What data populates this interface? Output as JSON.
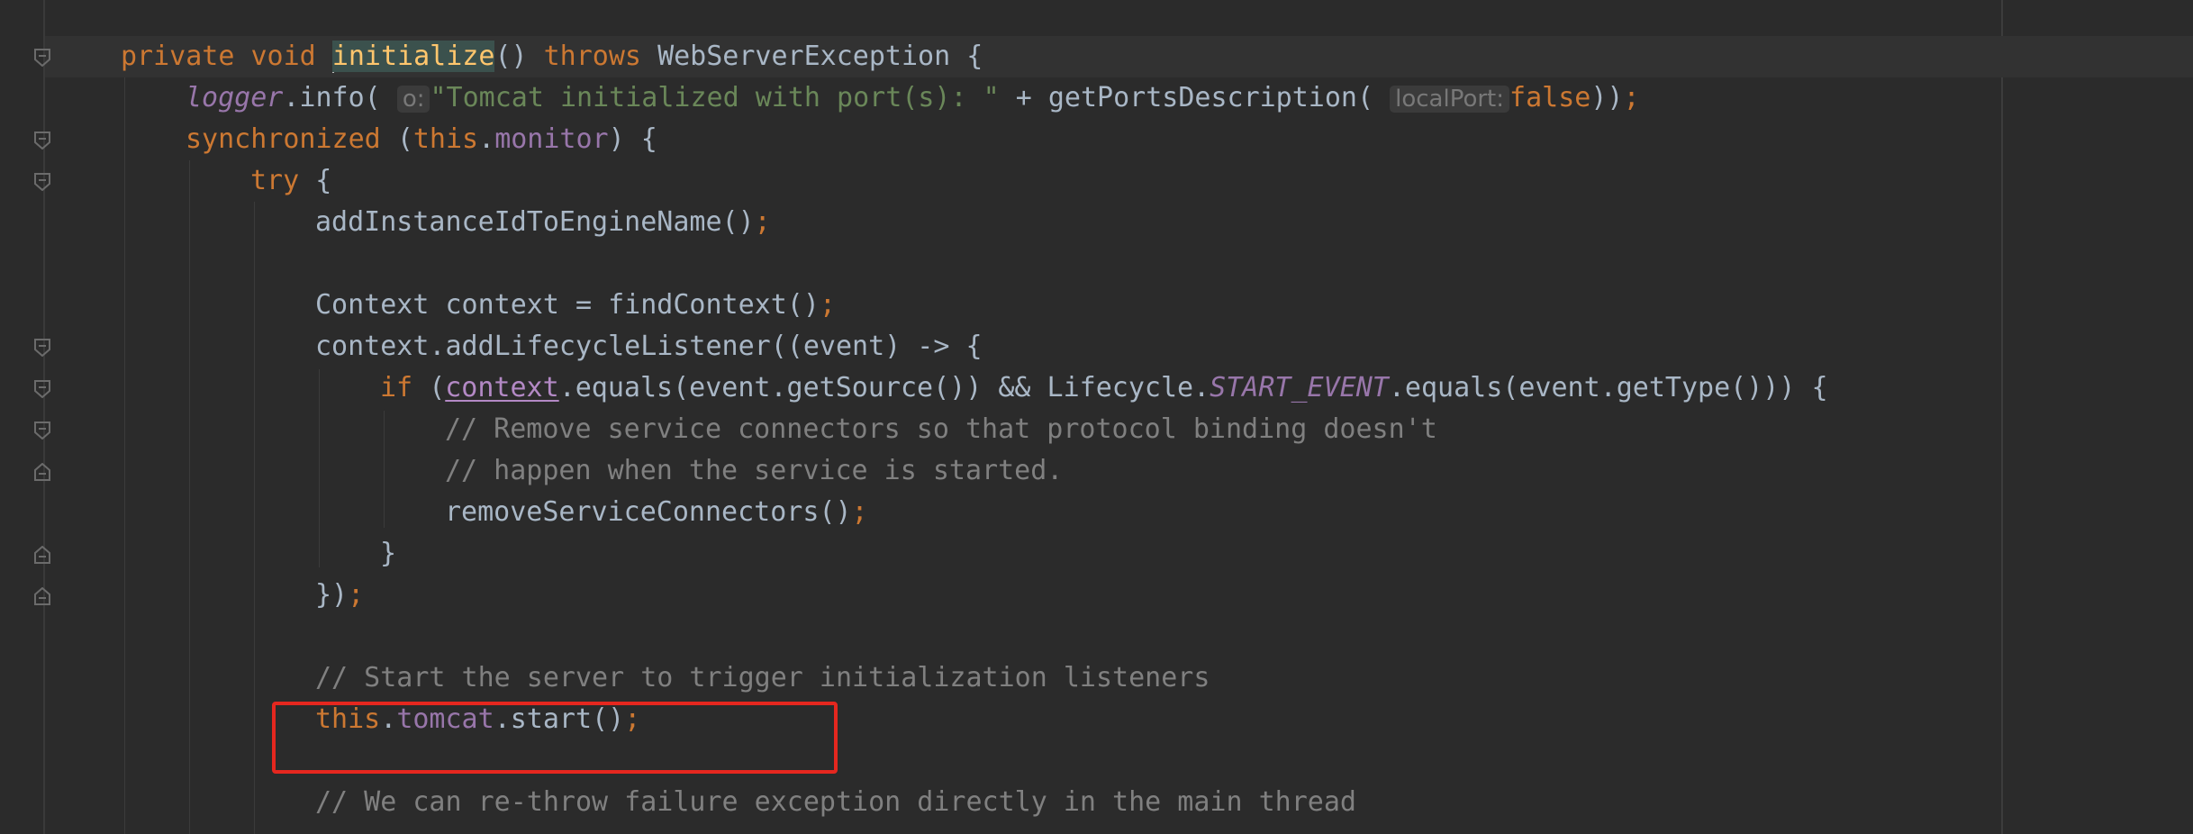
{
  "editor": {
    "lines": {
      "l1": {
        "private": "private ",
        "void": "void ",
        "method": "initialize",
        "parens": "() ",
        "throws": "throws ",
        "rest": "WebServerException {"
      },
      "l2": {
        "logger": "logger",
        "info": ".info( ",
        "hint": "o:",
        "str": "\"Tomcat initialized with port(s): \"",
        "mid": " + getPortsDescription( ",
        "hint2": "localPort:",
        "false": "false",
        "end": "))",
        "semi": ";"
      },
      "l3": {
        "sync": "synchronized ",
        "open": "(",
        "this": "this",
        "dot": ".",
        "monitor": "monitor",
        "close": ") {"
      },
      "l4": {
        "try": "try ",
        "brace": "{"
      },
      "l5": {
        "call": "addInstanceIdToEngineName()",
        "semi": ";"
      },
      "l6": {
        "call": "Context context = findContext()",
        "semi": ";"
      },
      "l7": {
        "text": "context.addLifecycleListener((event) -> {"
      },
      "l8": {
        "if": "if ",
        "open": "(",
        "context": "context",
        "mid": ".equals(event.getSource()) && Lifecycle.",
        "static": "START_EVENT",
        "end": ".equals(event.getType())) {"
      },
      "l9": {
        "comment": "// Remove service connectors so that protocol binding doesn't"
      },
      "l10": {
        "comment": "// happen when the service is started."
      },
      "l11": {
        "call": "removeServiceConnectors()",
        "semi": ";"
      },
      "l12": {
        "text": "}"
      },
      "l13": {
        "text": "})",
        "semi": ";"
      },
      "l14": {
        "comment": "// Start the server to trigger initialization listeners"
      },
      "l15": {
        "this": "this",
        "dot": ".",
        "tomcat": "tomcat",
        "start": ".start()",
        "semi": ";"
      },
      "l16": {
        "comment": "// We can re-throw failure exception directly in the main thread"
      }
    },
    "colors": {
      "background": "#2b2b2b",
      "keyword": "#cc7832",
      "method_decl": "#ffc66d",
      "string": "#6a8759",
      "field": "#9876aa",
      "comment": "#808080",
      "highlight_box": "#e5271f"
    }
  }
}
